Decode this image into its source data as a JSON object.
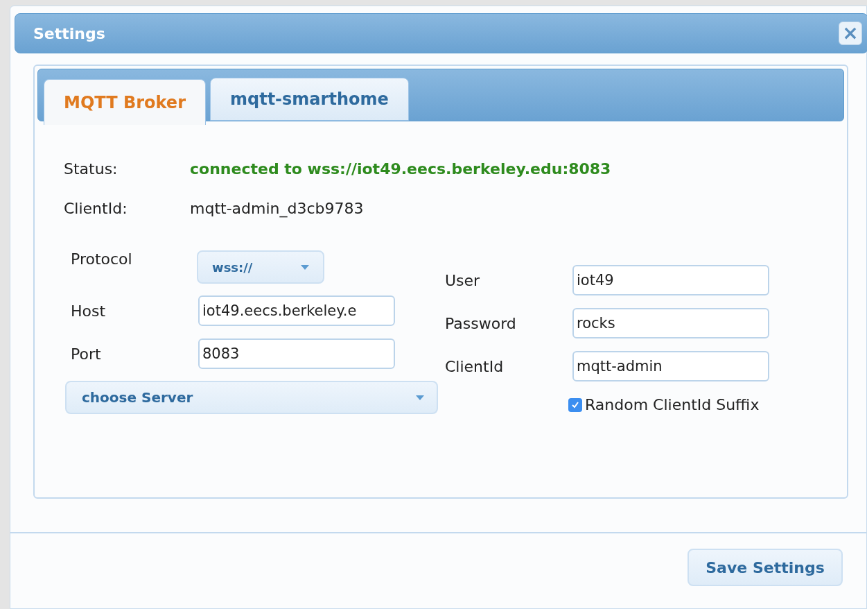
{
  "window": {
    "title": "Settings",
    "close_icon": "×"
  },
  "tabs": [
    {
      "label": "MQTT Broker",
      "selected": true
    },
    {
      "label": "mqtt-smarthome",
      "selected": false
    }
  ],
  "status": {
    "label": "Status:",
    "value": "connected to wss://iot49.eecs.berkeley.edu:8083"
  },
  "client_id": {
    "label": "ClientId:",
    "value": "mqtt-admin_d3cb9783"
  },
  "protocol": {
    "label": "Protocol",
    "value": "wss://"
  },
  "host": {
    "label": "Host",
    "value": "iot49.eecs.berkeley.e"
  },
  "port": {
    "label": "Port",
    "value": "8083"
  },
  "server_select": {
    "value": "choose Server"
  },
  "user": {
    "label": "User",
    "value": "iot49"
  },
  "password": {
    "label": "Password",
    "value": "rocks"
  },
  "client_id_field": {
    "label": "ClientId",
    "value": "mqtt-admin"
  },
  "random_suffix": {
    "label": "Random ClientId Suffix",
    "checked": true
  },
  "buttons": [
    "Save Settings"
  ]
}
